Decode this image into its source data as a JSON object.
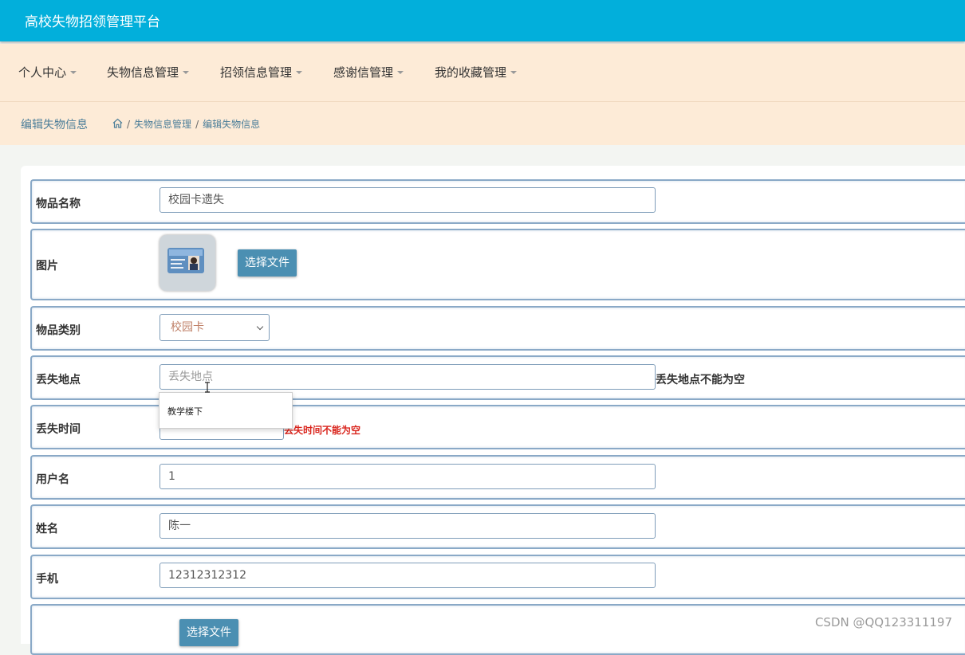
{
  "app": {
    "title": "高校失物招领管理平台"
  },
  "nav": {
    "items": [
      {
        "label": "个人中心"
      },
      {
        "label": "失物信息管理"
      },
      {
        "label": "招领信息管理"
      },
      {
        "label": "感谢信管理"
      },
      {
        "label": "我的收藏管理"
      }
    ]
  },
  "page": {
    "title": "编辑失物信息",
    "breadcrumb": {
      "home_icon": "home-icon",
      "sep": "/",
      "section": "失物信息管理",
      "current": "编辑失物信息"
    }
  },
  "form": {
    "item_name": {
      "label": "物品名称",
      "value": "校园卡遗失"
    },
    "image": {
      "label": "图片",
      "button": "选择文件"
    },
    "category": {
      "label": "物品类别",
      "value": "校园卡"
    },
    "location": {
      "label": "丢失地点",
      "placeholder": "丢失地点",
      "error": "丢失地点不能为空",
      "suggestion": "教学楼下"
    },
    "time": {
      "label": "丢失时间",
      "value": "",
      "error": "丢失时间不能为空"
    },
    "username": {
      "label": "用户名",
      "value": "1"
    },
    "name": {
      "label": "姓名",
      "value": "陈一"
    },
    "phone": {
      "label": "手机",
      "value": "12312312312"
    },
    "file2": {
      "button": "选择文件"
    }
  },
  "watermark": "CSDN @QQ123311197",
  "colors": {
    "topbar": "#02afdb",
    "nav_bg": "#fdebd7",
    "button": "#4b8fb2",
    "error": "#d9241c"
  }
}
